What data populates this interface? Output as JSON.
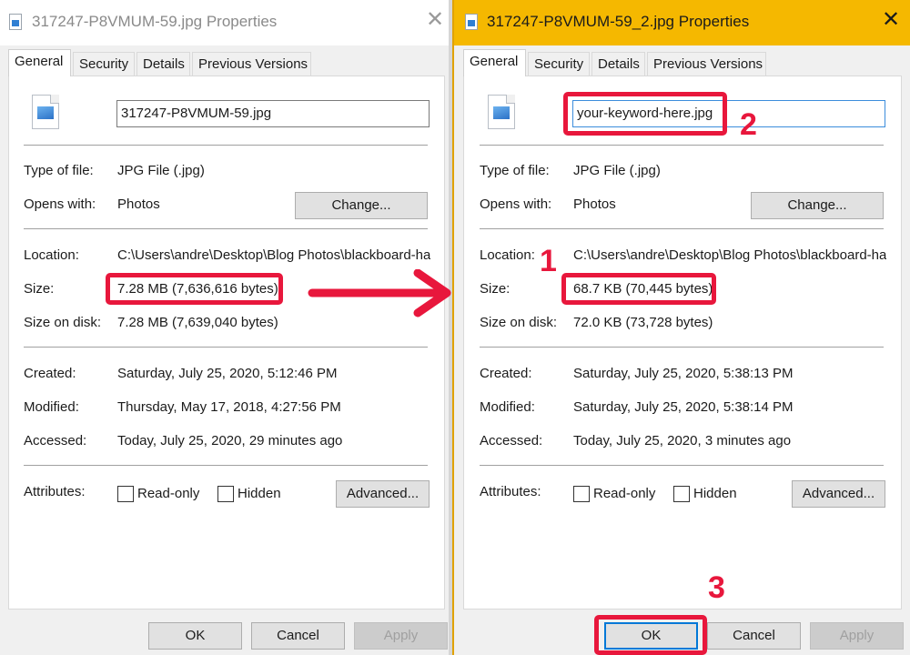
{
  "left_window": {
    "title": "317247-P8VMUM-59.jpg Properties",
    "tabs": [
      "General",
      "Security",
      "Details",
      "Previous Versions"
    ],
    "filename": "317247-P8VMUM-59.jpg",
    "type_label": "Type of file:",
    "type_value": "JPG File (.jpg)",
    "opens_label": "Opens with:",
    "opens_value": "Photos",
    "change_label": "Change...",
    "location_label": "Location:",
    "location_value": "C:\\Users\\andre\\Desktop\\Blog Photos\\blackboard-har",
    "size_label": "Size:",
    "size_value": "7.28 MB (7,636,616 bytes)",
    "size_disk_label": "Size on disk:",
    "size_disk_value": "7.28 MB (7,639,040 bytes)",
    "created_label": "Created:",
    "created_value": "Saturday, July 25, 2020, 5:12:46 PM",
    "modified_label": "Modified:",
    "modified_value": "Thursday, May 17, 2018, 4:27:56 PM",
    "accessed_label": "Accessed:",
    "accessed_value": "Today, July 25, 2020, 29 minutes ago",
    "attributes_label": "Attributes:",
    "readonly_label": "Read-only",
    "hidden_label": "Hidden",
    "advanced_label": "Advanced...",
    "ok_label": "OK",
    "cancel_label": "Cancel",
    "apply_label": "Apply"
  },
  "right_window": {
    "title": "317247-P8VMUM-59_2.jpg Properties",
    "tabs": [
      "General",
      "Security",
      "Details",
      "Previous Versions"
    ],
    "filename": "your-keyword-here.jpg",
    "type_label": "Type of file:",
    "type_value": "JPG File (.jpg)",
    "opens_label": "Opens with:",
    "opens_value": "Photos",
    "change_label": "Change...",
    "location_label": "Location:",
    "location_value": "C:\\Users\\andre\\Desktop\\Blog Photos\\blackboard-har",
    "size_label": "Size:",
    "size_value": "68.7 KB (70,445 bytes)",
    "size_disk_label": "Size on disk:",
    "size_disk_value": "72.0 KB (73,728 bytes)",
    "created_label": "Created:",
    "created_value": "Saturday, July 25, 2020, 5:38:13 PM",
    "modified_label": "Modified:",
    "modified_value": "Saturday, July 25, 2020, 5:38:14 PM",
    "accessed_label": "Accessed:",
    "accessed_value": "Today, July 25, 2020, 3 minutes ago",
    "attributes_label": "Attributes:",
    "readonly_label": "Read-only",
    "hidden_label": "Hidden",
    "advanced_label": "Advanced...",
    "ok_label": "OK",
    "cancel_label": "Cancel",
    "apply_label": "Apply"
  },
  "annotations": {
    "step1": "1",
    "step2": "2",
    "step3": "3"
  },
  "colors": {
    "annotation_red": "#e8173c",
    "active_titlebar": "#f5b800",
    "focus_blue": "#0078d7"
  },
  "icons": [
    "close-icon",
    "jpg-file-icon",
    "arrow-right-icon"
  ]
}
